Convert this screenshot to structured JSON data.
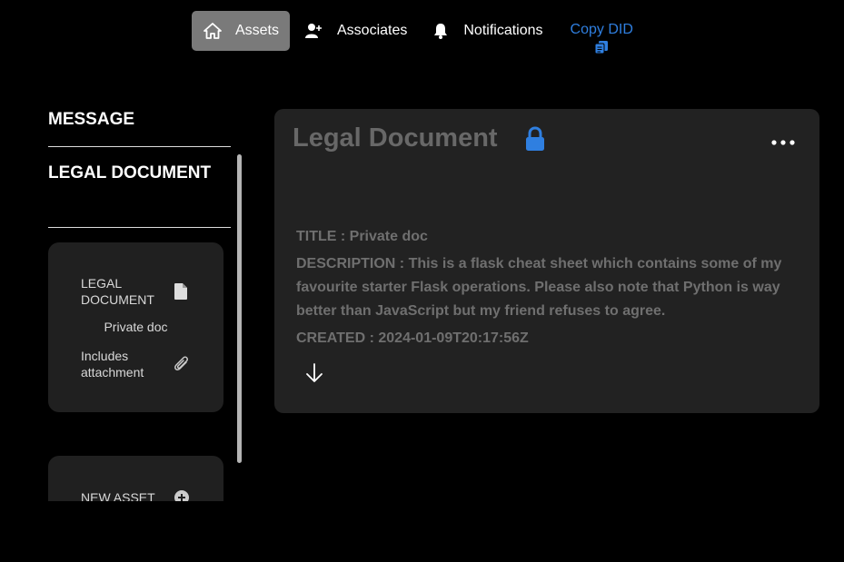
{
  "nav": {
    "items": [
      {
        "label": "Assets",
        "icon": "home-icon",
        "active": true
      },
      {
        "label": "Associates",
        "icon": "user-plus-icon"
      },
      {
        "label": "Notifications",
        "icon": "bell-icon"
      }
    ],
    "copy_did": {
      "label": "Copy DID",
      "icon": "copy-icon"
    }
  },
  "sidebar": {
    "headings": [
      "MESSAGE",
      "LEGAL DOCUMENT"
    ],
    "asset_card": {
      "type_label": "LEGAL DOCUMENT",
      "name": "Private doc",
      "attachment_label": "Includes attachment"
    },
    "new_asset_label": "NEW ASSET"
  },
  "panel": {
    "title": "Legal Document",
    "title_line": "TITLE : Private doc",
    "description_line": "DESCRIPTION : This is a flask cheat sheet which contains some of my favourite starter Flask operations. Please also note that Python is way better than JavaScript but my friend refuses to agree.",
    "created_line": "CREATED : 2024-01-09T20:17:56Z"
  },
  "colors": {
    "background": "#000000",
    "accent_blue": "#2f7fe0",
    "panel_bg": "#222222",
    "card_bg": "#202020",
    "active_nav": "#7a7a7a"
  }
}
